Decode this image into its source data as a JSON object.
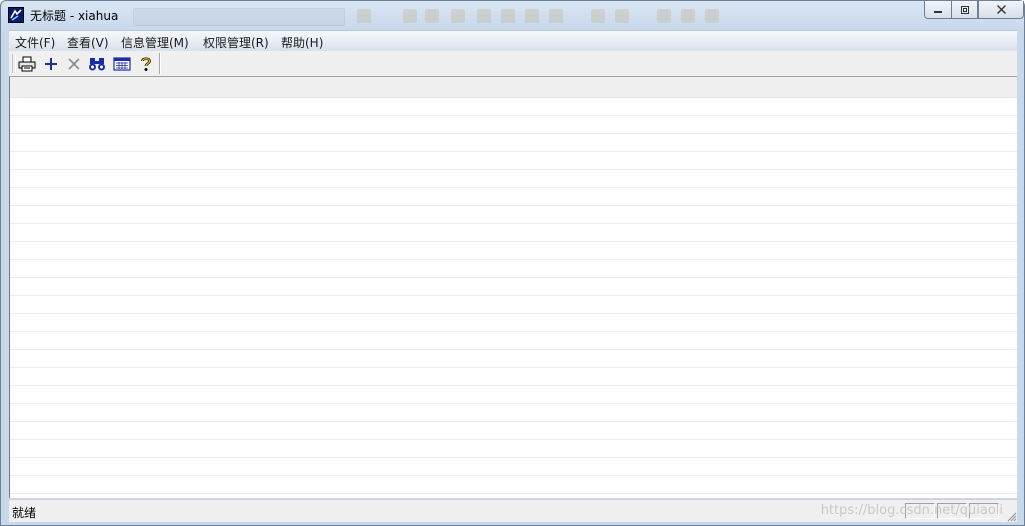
{
  "window": {
    "title": "无标题 - xiahua"
  },
  "menu": {
    "items": [
      {
        "label": "文件(F)"
      },
      {
        "label": "查看(V)"
      },
      {
        "label": "信息管理(M)"
      },
      {
        "label": "权限管理(R)"
      },
      {
        "label": "帮助(H)"
      }
    ]
  },
  "toolbar": {
    "buttons": [
      {
        "icon": "printer-icon"
      },
      {
        "icon": "plus-icon"
      },
      {
        "icon": "delete-x-icon"
      },
      {
        "icon": "binoculars-icon"
      },
      {
        "icon": "calendar-icon"
      },
      {
        "icon": "help-icon"
      }
    ]
  },
  "status": {
    "text": "就绪"
  },
  "watermark": {
    "text": "https://blog.csdn.net/quiaoli"
  },
  "colors": {
    "title_bg": "#c9d9ec",
    "menu_bg": "#e6ebf3",
    "content_bg": "#ffffff",
    "icon_blue": "#1b2ea8"
  }
}
